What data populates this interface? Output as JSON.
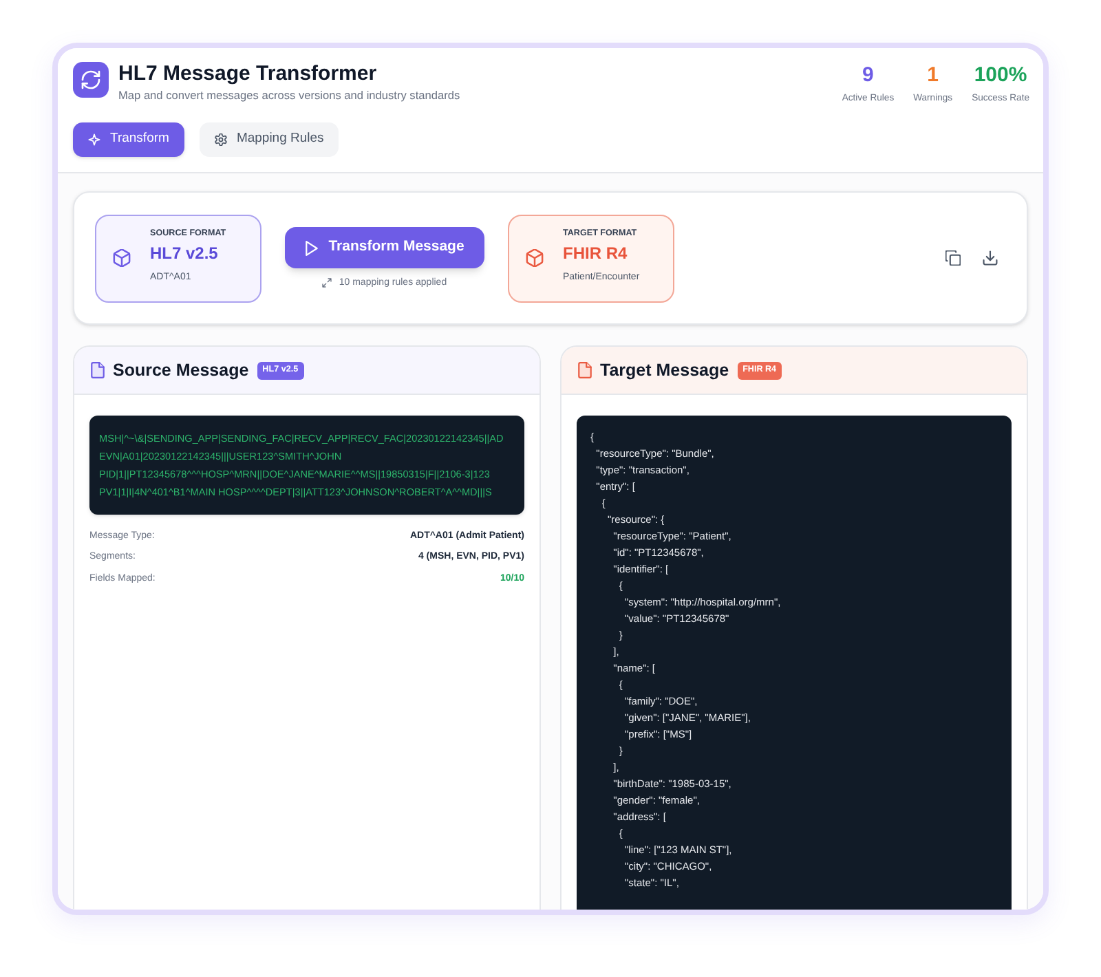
{
  "app": {
    "title": "HL7 Message Transformer",
    "subtitle": "Map and convert messages across versions and industry standards"
  },
  "stats": [
    {
      "value": "9",
      "label": "Active Rules",
      "color": "#6e5ce6"
    },
    {
      "value": "1",
      "label": "Warnings",
      "color": "#f07a2a"
    },
    {
      "value": "100%",
      "label": "Success Rate",
      "color": "#1ca35a"
    }
  ],
  "tabs": [
    {
      "label": "Transform",
      "selected": true
    },
    {
      "label": "Mapping Rules",
      "selected": false
    }
  ],
  "conversion": {
    "source": {
      "caption": "SOURCE FORMAT",
      "format": "HL7 v2.5",
      "detail": "ADT^A01"
    },
    "action": {
      "label": "Transform Message",
      "note": "10 mapping rules applied"
    },
    "target": {
      "caption": "TARGET FORMAT",
      "format": "FHIR R4",
      "detail": "Patient/Encounter"
    }
  },
  "source_message": {
    "title": "Source Message",
    "badge": "HL7 v2.5",
    "code_lines": [
      "MSH|^~\\&|SENDING_APP|SENDING_FAC|RECV_APP|RECV_FAC|20230122142345||AD",
      "EVN|A01|20230122142345|||USER123^SMITH^JOHN",
      "PID|1||PT12345678^^^HOSP^MRN||DOE^JANE^MARIE^^MS||19850315|F||2106-3|123",
      "PV1|1|I|4N^401^B1^MAIN HOSP^^^^DEPT|3||ATT123^JOHNSON^ROBERT^A^^MD|||S"
    ],
    "details": [
      {
        "label": "Message Type:",
        "value": "ADT^A01 (Admit Patient)",
        "kind": "plain"
      },
      {
        "label": "Segments:",
        "value": "4 (MSH, EVN, PID, PV1)",
        "kind": "plain"
      },
      {
        "label": "Fields Mapped:",
        "value": "10/10",
        "kind": "success"
      }
    ]
  },
  "target_message": {
    "title": "Target Message",
    "badge": "FHIR R4",
    "code_lines": [
      "{",
      "  \"resourceType\": \"Bundle\",",
      "  \"type\": \"transaction\",",
      "  \"entry\": [",
      "    {",
      "      \"resource\": {",
      "        \"resourceType\": \"Patient\",",
      "        \"id\": \"PT12345678\",",
      "        \"identifier\": [",
      "          {",
      "            \"system\": \"http://hospital.org/mrn\",",
      "            \"value\": \"PT12345678\"",
      "          }",
      "        ],",
      "        \"name\": [",
      "          {",
      "            \"family\": \"DOE\",",
      "            \"given\": [\"JANE\", \"MARIE\"],",
      "            \"prefix\": [\"MS\"]",
      "          }",
      "        ],",
      "        \"birthDate\": \"1985-03-15\",",
      "        \"gender\": \"female\",",
      "        \"address\": [",
      "          {",
      "            \"line\": [\"123 MAIN ST\"],",
      "            \"city\": \"CHICAGO\",",
      "            \"state\": \"IL\","
    ]
  }
}
